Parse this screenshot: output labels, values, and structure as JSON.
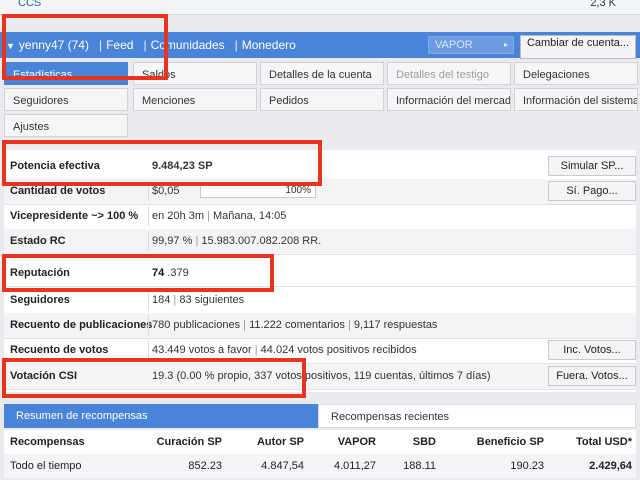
{
  "top": {
    "left_label": "CCS",
    "right_value": "2,3 K"
  },
  "navbar": {
    "account": "yenny47 (74)",
    "links": [
      "Feed",
      "Comunidades",
      "Monedero"
    ],
    "currency_select": "VAPOR",
    "change_account_button": "Cambiar de cuenta..."
  },
  "tabs": [
    {
      "label": "Estadísticas",
      "active": true
    },
    {
      "label": "Saldos"
    },
    {
      "label": "Detalles de la cuenta"
    },
    {
      "label": "Detalles del testigo",
      "disabled": true
    },
    {
      "label": "Delegaciones"
    },
    {
      "label": "Seguidores"
    },
    {
      "label": "Menciones"
    },
    {
      "label": "Pedidos"
    },
    {
      "label": "Información del mercado"
    },
    {
      "label": "Información del sistema"
    },
    {
      "label": "Ajustes"
    }
  ],
  "stats": {
    "effective_power": {
      "label": "Potencia efectiva",
      "value": "9.484,23 SP",
      "button": "Simular SP..."
    },
    "vote_amount": {
      "label": "Cantidad de votos",
      "value": "$0,05",
      "percent": "100%",
      "percent_value": 100,
      "button": "Sí. Pago..."
    },
    "vp": {
      "label": "Vicepresidente ~> 100 %",
      "value": "en 20h 3m",
      "value2": "Mañana, 14:05"
    },
    "rc": {
      "label": "Estado RC",
      "value": "99,97 %",
      "value2": "15.983.007.082.208 RR."
    },
    "reputation": {
      "label": "Reputación",
      "value_main": "74",
      "value_dec": ".379"
    },
    "followers": {
      "label": "Seguidores",
      "value": "184",
      "value2": "83 siguientes"
    },
    "posts": {
      "label": "Recuento de publicaciones",
      "value": "780 publicaciones",
      "value2": "11.222 comentarios",
      "value3": "9,117 respuestas"
    },
    "votes": {
      "label": "Recuento de votos",
      "value": "43.449 votos a favor",
      "value2": "44.024 votos positivos recibidos",
      "button": "Inc. Votos..."
    },
    "csi": {
      "label": "Votación CSI",
      "value": "19.3",
      "detail": "(0.00 % propio, 337 votos positivos, 119 cuentas, últimos 7 días)",
      "button": "Fuera. Votos..."
    }
  },
  "rewards": {
    "tabs": [
      "Resumen de recompensas",
      "Recompensas recientes"
    ],
    "headers": [
      "Recompensas",
      "Curación SP",
      "Autor SP",
      "VAPOR",
      "SBD",
      "Beneficio SP",
      "Total USD*"
    ],
    "rows": [
      [
        "Todo el tiempo",
        "852.23",
        "4.847,54",
        "4.011,27",
        "188.11",
        "190.23",
        "2.429,64"
      ]
    ]
  },
  "colors": {
    "accent": "#4a84d8",
    "highlight": "#e8331f"
  }
}
